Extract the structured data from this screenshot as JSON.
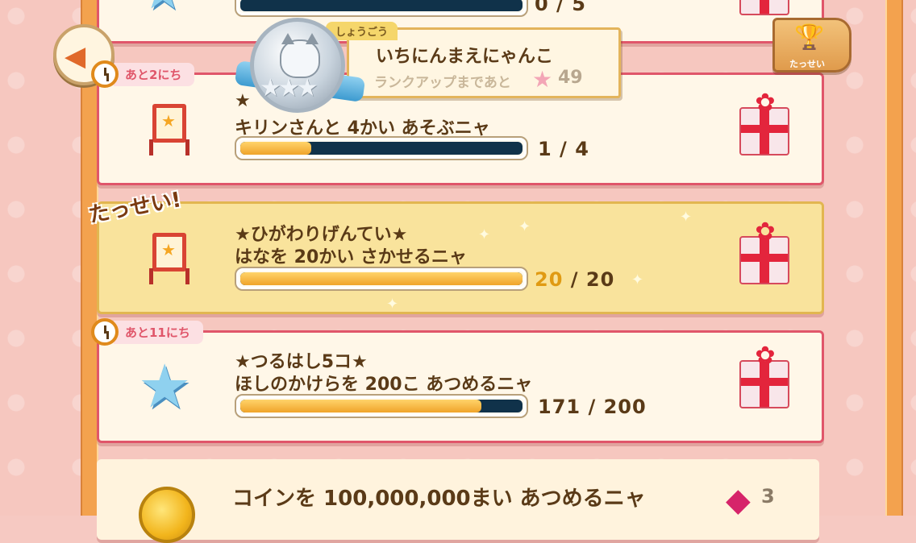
{
  "header": {
    "title_tag": "しょうごう",
    "title_name": "いちにんまえにゃんこ",
    "rankup_label": "ランクアップまであと",
    "rankup_value": "49",
    "achievement_button_label": "たっせい"
  },
  "missions": [
    {
      "id": "top",
      "title": "",
      "description": "",
      "current": "0",
      "total": "5",
      "progress": 0,
      "deadline": "",
      "status": "in-progress"
    },
    {
      "id": "giraffe",
      "title": "★",
      "description": "キリンさんと 4かい あそぶニャ",
      "current": "1",
      "total": "4",
      "progress": 0.25,
      "deadline": "あと2にち",
      "status": "in-progress"
    },
    {
      "id": "sunflower",
      "title": "★ひがわりげんてい★",
      "description": "はなを 20かい さかせるニャ",
      "current": "20",
      "total": "20",
      "progress": 1.0,
      "deadline": "",
      "badge": "たっせい!",
      "status": "done"
    },
    {
      "id": "crane",
      "title": "★つるはし5コ★",
      "description": "ほしのかけらを 200こ あつめるニャ",
      "current": "171",
      "total": "200",
      "progress": 0.855,
      "deadline": "あと11にち",
      "status": "in-progress"
    },
    {
      "id": "coins",
      "title": "",
      "description": "コインを 100,000,000まい あつめるニャ",
      "reward_count": "3",
      "status": "locked"
    }
  ],
  "colors": {
    "accent_border": "#e0566a",
    "done_border": "#e2b650",
    "bar_fill": "#f0a42a",
    "bar_track": "#10324a"
  },
  "icons": {
    "back": "back-arrow-icon",
    "achievement": "trophy-icon",
    "reward": "gift-box-icon",
    "gem": "gem-icon",
    "coin": "coin-icon"
  }
}
